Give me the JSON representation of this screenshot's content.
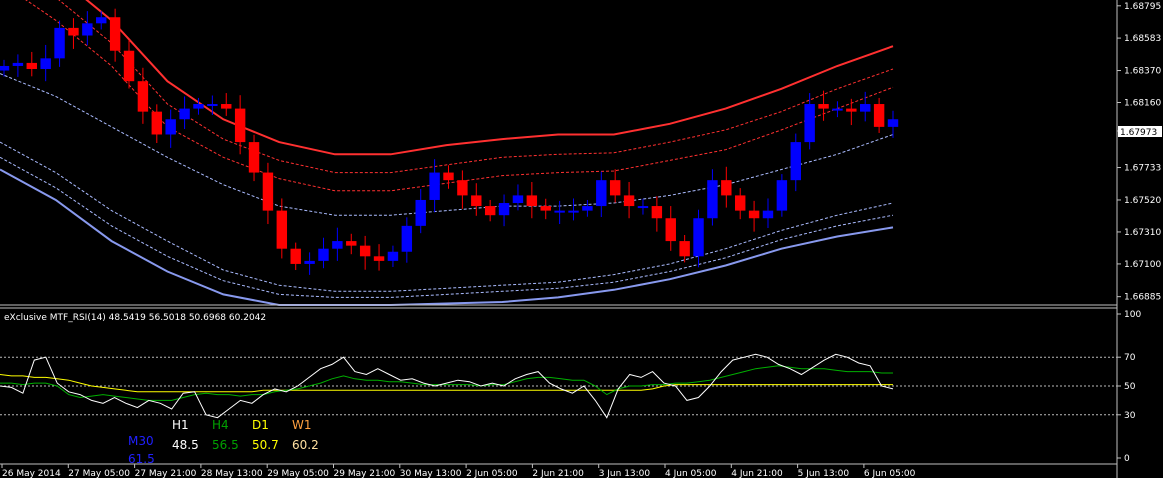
{
  "chart_data": [
    {
      "type": "candlestick",
      "title": "",
      "ylim": [
        1.6685,
        1.6882
      ],
      "y_ticks": [
        "1.68795",
        "1.68583",
        "1.68370",
        "1.68160",
        "1.67973",
        "1.67733",
        "1.67520",
        "1.67310",
        "1.67100",
        "1.66885"
      ],
      "current_price": "1.67973",
      "colors": {
        "bull": "#0000ff",
        "bear": "#ff0000",
        "band_outer_upper": "#ff3030",
        "band_outer_lower": "#8899ee",
        "band_inner": "#aabbff"
      },
      "candles_close": [
        1.684,
        1.6842,
        1.6838,
        1.6845,
        1.6865,
        1.686,
        1.6868,
        1.6872,
        1.685,
        1.683,
        1.681,
        1.6795,
        1.6805,
        1.6812,
        1.6815,
        1.6815,
        1.6812,
        1.679,
        1.677,
        1.6745,
        1.672,
        1.671,
        1.6712,
        1.672,
        1.6725,
        1.6722,
        1.6715,
        1.6712,
        1.6718,
        1.6735,
        1.6752,
        1.677,
        1.6765,
        1.6755,
        1.6748,
        1.6742,
        1.675,
        1.6755,
        1.6748,
        1.6745,
        1.6745,
        1.6745,
        1.6748,
        1.6765,
        1.6755,
        1.6748,
        1.6748,
        1.674,
        1.6725,
        1.6715,
        1.674,
        1.6765,
        1.6755,
        1.6745,
        1.674,
        1.6745,
        1.6765,
        1.679,
        1.6815,
        1.6812,
        1.6812,
        1.681,
        1.6815,
        1.68,
        1.6805
      ],
      "bands": {
        "upper_outer": [
          1.6925,
          1.69,
          1.687,
          1.683,
          1.6805,
          1.679,
          1.6782,
          1.6782,
          1.6788,
          1.6792,
          1.6795,
          1.6795,
          1.6802,
          1.6812,
          1.6825,
          1.684,
          1.6853
        ],
        "upper_mid": [
          1.691,
          1.6885,
          1.6855,
          1.6815,
          1.6792,
          1.6778,
          1.677,
          1.677,
          1.6775,
          1.678,
          1.6782,
          1.6783,
          1.679,
          1.6798,
          1.681,
          1.6825,
          1.6838
        ],
        "upper_inner": [
          1.6895,
          1.687,
          1.684,
          1.68,
          1.678,
          1.6766,
          1.6758,
          1.6758,
          1.6763,
          1.6768,
          1.677,
          1.6771,
          1.6778,
          1.6785,
          1.6798,
          1.6812,
          1.6826
        ],
        "middle": [
          1.6835,
          1.682,
          1.68,
          1.678,
          1.6762,
          1.6748,
          1.6742,
          1.6742,
          1.6745,
          1.6748,
          1.6748,
          1.675,
          1.6755,
          1.6762,
          1.6772,
          1.6782,
          1.6795
        ],
        "lower_inner": [
          1.679,
          1.677,
          1.6745,
          1.6725,
          1.6706,
          1.6696,
          1.6692,
          1.6692,
          1.6694,
          1.6696,
          1.6698,
          1.6703,
          1.671,
          1.672,
          1.6732,
          1.6742,
          1.675
        ],
        "lower_mid": [
          1.678,
          1.676,
          1.6735,
          1.6715,
          1.6699,
          1.669,
          1.6688,
          1.6688,
          1.669,
          1.6692,
          1.6694,
          1.6698,
          1.6705,
          1.6714,
          1.6726,
          1.6735,
          1.6742
        ],
        "lower_outer": [
          1.6772,
          1.6752,
          1.6725,
          1.6705,
          1.669,
          1.6683,
          1.6683,
          1.6683,
          1.6684,
          1.6685,
          1.6688,
          1.6693,
          1.67,
          1.6709,
          1.672,
          1.6728,
          1.6734
        ]
      }
    },
    {
      "type": "line",
      "title": "eXclusive MTF_RSI(14) 48.5419 56.5018 50.6968 60.2042",
      "ylim": [
        0,
        100
      ],
      "y_ticks": [
        "100",
        "70",
        "50",
        "30",
        "0"
      ],
      "levels": [
        70,
        50,
        30
      ],
      "series": [
        {
          "name": "M30",
          "color": "#0000ff",
          "value_label": "61.5"
        },
        {
          "name": "H1",
          "color": "#ffffff",
          "value_label": "48.5",
          "values": [
            50,
            49,
            45,
            68,
            70,
            52,
            46,
            44,
            40,
            38,
            42,
            38,
            35,
            40,
            38,
            34,
            45,
            46,
            30,
            28,
            34,
            40,
            38,
            44,
            48,
            46,
            50,
            56,
            62,
            65,
            70,
            60,
            58,
            62,
            58,
            54,
            55,
            52,
            50,
            52,
            54,
            53,
            50,
            52,
            50,
            55,
            58,
            60,
            52,
            48,
            45,
            50,
            40,
            28,
            48,
            58,
            56,
            60,
            52,
            50,
            40,
            42,
            50,
            60,
            68,
            70,
            72,
            70,
            65,
            62,
            58,
            63,
            68,
            72,
            70,
            66,
            64,
            50,
            48
          ]
        },
        {
          "name": "H4",
          "color": "#00b000",
          "value_label": "56.5",
          "values": [
            52,
            52,
            51,
            52,
            52,
            50,
            44,
            42,
            43,
            44,
            43,
            42,
            41,
            40,
            40,
            40,
            42,
            44,
            45,
            44,
            44,
            43,
            44,
            44,
            46,
            47,
            48,
            50,
            52,
            55,
            57,
            55,
            54,
            54,
            53,
            53,
            52,
            51,
            51,
            51,
            51,
            51,
            50,
            51,
            51,
            53,
            55,
            56,
            56,
            55,
            54,
            54,
            50,
            44,
            48,
            50,
            50,
            51,
            51,
            52,
            52,
            53,
            54,
            56,
            58,
            60,
            62,
            63,
            64,
            63,
            62,
            62,
            62,
            61,
            60,
            60,
            60,
            59,
            59
          ]
        },
        {
          "name": "D1",
          "color": "#ffff00",
          "value_label": "50.7",
          "values": [
            58,
            57,
            57,
            56,
            56,
            55,
            54,
            52,
            50,
            49,
            48,
            47,
            46,
            46,
            46,
            46,
            46,
            46,
            46,
            46,
            46,
            46,
            46,
            47,
            47,
            47,
            47,
            47,
            47,
            47,
            47,
            47,
            47,
            47,
            47,
            47,
            47,
            47,
            47,
            47,
            47,
            47,
            47,
            47,
            47,
            47,
            47,
            47,
            47,
            47,
            47,
            47,
            47,
            47,
            47,
            47,
            47,
            48,
            50,
            51,
            51,
            51,
            51,
            51,
            51,
            51,
            51,
            51,
            51,
            51,
            51,
            51,
            51,
            51,
            51,
            51,
            51,
            51,
            51
          ]
        },
        {
          "name": "W1",
          "color": "#ffa040",
          "value_label": "60.2"
        }
      ]
    }
  ],
  "x_ticks": [
    "26 May 2014",
    "27 May 05:00",
    "27 May 21:00",
    "28 May 13:00",
    "29 May 05:00",
    "29 May 21:00",
    "30 May 13:00",
    "2 Jun 05:00",
    "2 Jun 21:00",
    "3 Jun 13:00",
    "4 Jun 05:00",
    "4 Jun 21:00",
    "5 Jun 13:00",
    "6 Jun 05:00"
  ]
}
